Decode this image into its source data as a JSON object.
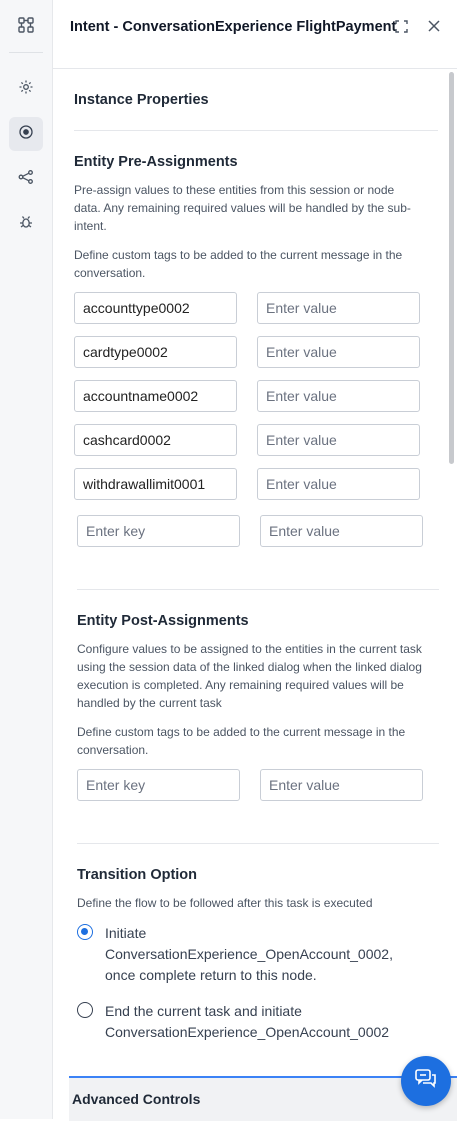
{
  "header": {
    "title": "Intent - ConversationExperience FlightPayment"
  },
  "rail": {
    "items": [
      {
        "icon": "flow-icon"
      },
      {
        "icon": "settings-gear-icon"
      },
      {
        "icon": "target-icon",
        "active": true
      },
      {
        "icon": "connections-icon"
      },
      {
        "icon": "bug-icon"
      }
    ]
  },
  "instance": {
    "title": "Instance Properties"
  },
  "pre": {
    "title": "Entity Pre-Assignments",
    "description": "Pre-assign values to these entities from this session or node data. Any remaining required values will be handled by the sub-intent.",
    "tags_description": "Define custom tags to be added to the current message in the conversation.",
    "rows": [
      {
        "key": "accounttype0002",
        "value_placeholder": "Enter value"
      },
      {
        "key": "cardtype0002",
        "value_placeholder": "Enter value"
      },
      {
        "key": "accountname0002",
        "value_placeholder": "Enter value"
      },
      {
        "key": "cashcard0002",
        "value_placeholder": "Enter value"
      },
      {
        "key": "withdrawallimit0001",
        "value_placeholder": "Enter value"
      }
    ],
    "new_key_placeholder": "Enter key",
    "new_value_placeholder": "Enter value"
  },
  "post": {
    "title": "Entity Post-Assignments",
    "description": "Configure values to be assigned to the entities in the current task using the session data of the linked dialog when the linked dialog execution is completed. Any remaining required values will be handled by the current task",
    "tags_description": "Define custom tags to be added to the current message in the conversation.",
    "new_key_placeholder": "Enter key",
    "new_value_placeholder": "Enter value"
  },
  "transition": {
    "title": "Transition Option",
    "description": "Define the flow to be followed after this task is executed",
    "options": [
      {
        "label": "Initiate ConversationExperience_OpenAccount_0002, once complete return to this node.",
        "selected": true
      },
      {
        "label": "End the current task and initiate ConversationExperience_OpenAccount_0002",
        "selected": false
      }
    ]
  },
  "advanced": {
    "title": "Advanced Controls"
  },
  "colors": {
    "accent": "#1d6fe0",
    "rail_bg": "#f6f7f9",
    "divider": "#e5e7eb"
  }
}
